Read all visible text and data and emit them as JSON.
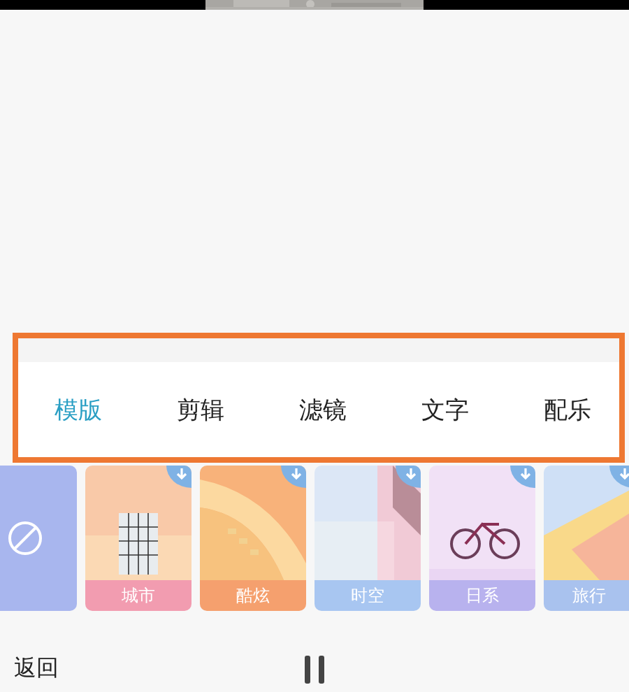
{
  "tabs": [
    {
      "label": "模版",
      "selected": true
    },
    {
      "label": "剪辑",
      "selected": false
    },
    {
      "label": "滤镜",
      "selected": false
    },
    {
      "label": "文字",
      "selected": false
    },
    {
      "label": "配乐",
      "selected": false
    }
  ],
  "templates": [
    {
      "kind": "none"
    },
    {
      "kind": "template",
      "label": "城市",
      "color": "#f29cb0",
      "downloadable": true
    },
    {
      "kind": "template",
      "label": "酷炫",
      "color": "#f5a06e",
      "downloadable": true
    },
    {
      "kind": "template",
      "label": "时空",
      "color": "#a8c6f1",
      "downloadable": true
    },
    {
      "kind": "template",
      "label": "日系",
      "color": "#b8b2ee",
      "downloadable": true
    },
    {
      "kind": "template",
      "label": "旅行",
      "color": "#a9c2ee",
      "downloadable": true
    }
  ],
  "bottom_bar": {
    "back": "返回",
    "playing": true
  }
}
